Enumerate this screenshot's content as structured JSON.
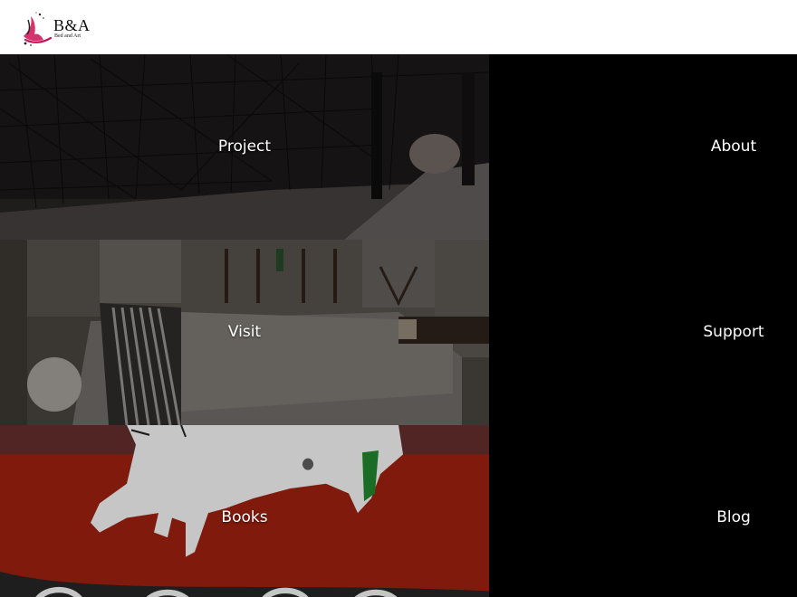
{
  "brand": {
    "title": "B&A",
    "subtitle": "Bed and Art",
    "colors": {
      "accent": "#d6336c",
      "header_bg": "#ffffff",
      "page_bg": "#000000"
    }
  },
  "tiles": [
    {
      "label": "Project",
      "image": "dark-forest-installation"
    },
    {
      "label": "Visit",
      "image": "bedroom-interior"
    },
    {
      "label": "Books",
      "image": "red-painting-white-pig"
    }
  ],
  "side_links": [
    {
      "label": "About"
    },
    {
      "label": "Support"
    },
    {
      "label": "Blog"
    }
  ]
}
